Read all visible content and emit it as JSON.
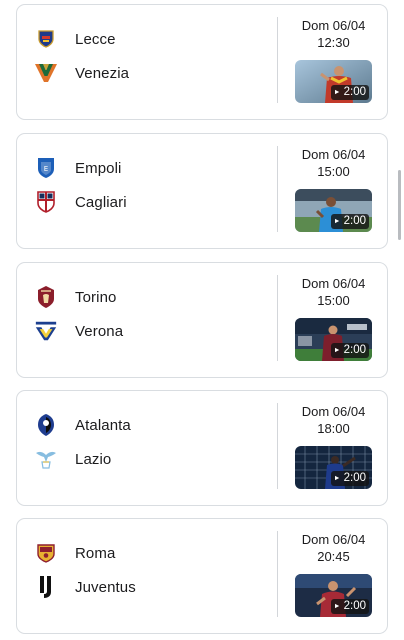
{
  "matches": [
    {
      "home": {
        "name": "Lecce",
        "crest": "lecce-crest"
      },
      "away": {
        "name": "Venezia",
        "crest": "venezia-crest"
      },
      "date": "Dom 06/04",
      "time": "12:30",
      "video": {
        "duration": "2:00",
        "play_icon": "►"
      }
    },
    {
      "home": {
        "name": "Empoli",
        "crest": "empoli-crest"
      },
      "away": {
        "name": "Cagliari",
        "crest": "cagliari-crest"
      },
      "date": "Dom 06/04",
      "time": "15:00",
      "video": {
        "duration": "2:00",
        "play_icon": "►"
      }
    },
    {
      "home": {
        "name": "Torino",
        "crest": "torino-crest"
      },
      "away": {
        "name": "Verona",
        "crest": "verona-crest"
      },
      "date": "Dom 06/04",
      "time": "15:00",
      "video": {
        "duration": "2:00",
        "play_icon": "►"
      }
    },
    {
      "home": {
        "name": "Atalanta",
        "crest": "atalanta-crest"
      },
      "away": {
        "name": "Lazio",
        "crest": "lazio-crest"
      },
      "date": "Dom 06/04",
      "time": "18:00",
      "video": {
        "duration": "2:00",
        "play_icon": "►"
      }
    },
    {
      "home": {
        "name": "Roma",
        "crest": "roma-crest"
      },
      "away": {
        "name": "Juventus",
        "crest": "juventus-crest"
      },
      "date": "Dom 06/04",
      "time": "20:45",
      "video": {
        "duration": "2:00",
        "play_icon": "►"
      }
    }
  ],
  "colors": {
    "card_border": "#d9dde1",
    "divider": "#d3d6da",
    "text": "#1c1c1e",
    "duration_badge": "#141414"
  }
}
